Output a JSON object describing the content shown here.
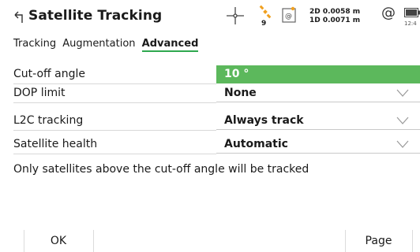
{
  "header": {
    "title": "Satellite Tracking",
    "satellite_count": "9",
    "precision_2d": "2D 0.0058 m",
    "precision_1d": "1D 0.0071 m",
    "at_symbol": "@",
    "clock": "12:4"
  },
  "tabs": [
    {
      "label": "Tracking",
      "active": false
    },
    {
      "label": "Augmentation",
      "active": false
    },
    {
      "label": "Advanced",
      "active": true
    }
  ],
  "fields": {
    "cutoff": {
      "label": "Cut-off angle",
      "value": "10 °"
    },
    "dop": {
      "label": "DOP limit",
      "value": "None"
    },
    "l2c": {
      "label": "L2C tracking",
      "value": "Always track"
    },
    "health": {
      "label": "Satellite health",
      "value": "Automatic"
    }
  },
  "info_text": "Only satellites above the cut-off angle will be tracked",
  "softkeys": {
    "ok": "OK",
    "page": "Page"
  },
  "colors": {
    "accent_green": "#5cb85c",
    "tab_underline": "#2fa84f",
    "satellite_orange": "#f0a020"
  }
}
